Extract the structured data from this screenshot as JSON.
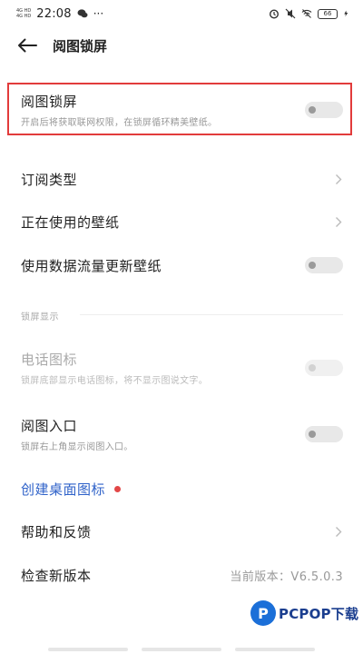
{
  "status_bar": {
    "signal_top": "4G HD",
    "signal_bottom": "4G HD",
    "time": "22:08",
    "dots": "···",
    "battery": "66"
  },
  "header": {
    "title": "阅图锁屏"
  },
  "settings": {
    "lock_wallpaper": {
      "title": "阅图锁屏",
      "subtitle": "开启后将获取联网权限，在锁屏循环精美壁纸。",
      "enabled": false
    },
    "subscription_type": {
      "title": "订阅类型"
    },
    "current_wallpaper": {
      "title": "正在使用的壁纸"
    },
    "mobile_data_update": {
      "title": "使用数据流量更新壁纸",
      "enabled": false
    },
    "section_lock_display": "锁屏显示",
    "phone_icon": {
      "title": "电话图标",
      "subtitle": "锁屏底部显示电话图标，将不显示图说文字。",
      "enabled": false
    },
    "entry": {
      "title": "阅图入口",
      "subtitle": "锁屏右上角显示阅图入口。",
      "enabled": false
    },
    "create_shortcut": {
      "title": "创建桌面图标"
    },
    "help_feedback": {
      "title": "帮助和反馈"
    },
    "check_update": {
      "title": "检查新版本",
      "value": "当前版本：V6.5.0.3"
    }
  },
  "watermark": {
    "logo_letter": "P",
    "text": "PCPOP下载"
  },
  "colors": {
    "highlight": "#e23b3b",
    "link": "#2f62c9",
    "badge": "#e24747"
  }
}
